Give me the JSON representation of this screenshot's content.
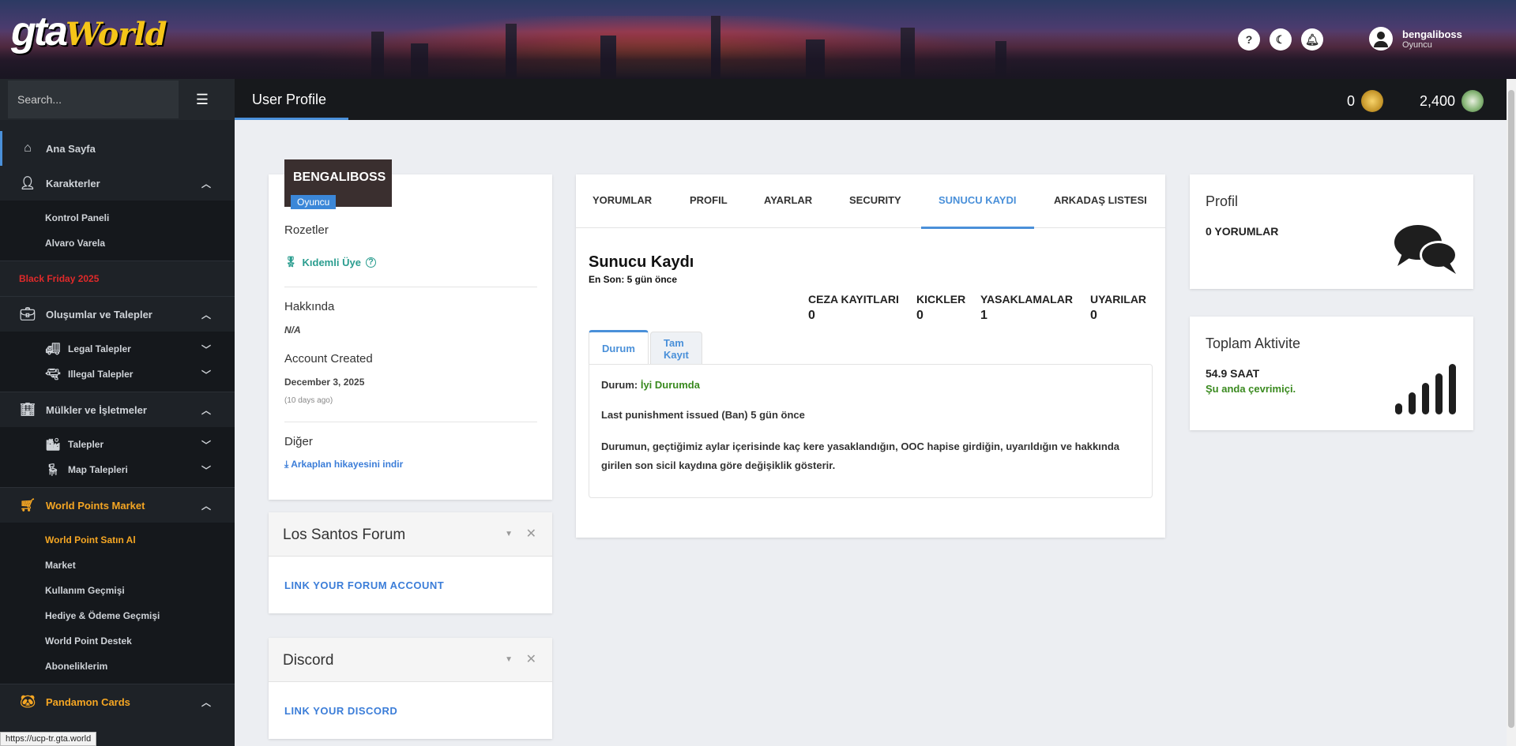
{
  "header": {
    "logo_main": "gta",
    "logo_sub": "World",
    "help_icon": "?",
    "user_name": "bengaliboss",
    "user_role": "Oyuncu"
  },
  "sidebar": {
    "search_placeholder": "Search...",
    "items": [
      {
        "label": "Ana Sayfa"
      },
      {
        "label": "Karakterler"
      },
      {
        "label": "Kontrol Paneli"
      },
      {
        "label": "Alvaro Varela"
      },
      {
        "label": "Black Friday 2025"
      },
      {
        "label": "Oluşumlar ve Talepler"
      },
      {
        "label": "Legal Talepler"
      },
      {
        "label": "Illegal Talepler"
      },
      {
        "label": "Mülkler ve İşletmeler"
      },
      {
        "label": "Talepler"
      },
      {
        "label": "Map Talepleri"
      },
      {
        "label": "World Points Market"
      },
      {
        "label": "World Point Satın Al"
      },
      {
        "label": "Market"
      },
      {
        "label": "Kullanım Geçmişi"
      },
      {
        "label": "Hediye & Ödeme Geçmişi"
      },
      {
        "label": "World Point Destek"
      },
      {
        "label": "Aboneliklerim"
      },
      {
        "label": "Pandamon Cards"
      }
    ],
    "status_url": "https://ucp-tr.gta.world"
  },
  "topbar": {
    "title": "User Profile",
    "points_gold": "0",
    "points_green": "2,400"
  },
  "profile": {
    "name": "BENGALIBOSS",
    "role": "Oyuncu",
    "badges_label": "Rozetler",
    "badge": "Kıdemli Üye",
    "about_label": "Hakkında",
    "about_value": "N/A",
    "created_label": "Account Created",
    "created_value": "December 3, 2025",
    "created_ago": "(10 days ago)",
    "other_label": "Diğer",
    "download_link": "Arkaplan hikayesini indir"
  },
  "forum": {
    "title": "Los Santos Forum",
    "link": "LINK YOUR FORUM ACCOUNT"
  },
  "discord": {
    "title": "Discord",
    "link": "LINK YOUR DISCORD"
  },
  "main": {
    "tabs": [
      {
        "label": "YORUMLAR"
      },
      {
        "label": "PROFIL"
      },
      {
        "label": "AYARLAR"
      },
      {
        "label": "SECURITY"
      },
      {
        "label": "SUNUCU KAYDI"
      },
      {
        "label": "ARKADAŞ LISTESI"
      }
    ],
    "title": "Sunucu Kaydı",
    "subtitle": "En Son: 5 gün önce",
    "stats": [
      {
        "label": "CEZA KAYITLARI",
        "value": "0"
      },
      {
        "label": "KICKLER",
        "value": "0"
      },
      {
        "label": "YASAKLAMALAR",
        "value": "1"
      },
      {
        "label": "UYARILAR",
        "value": "0"
      }
    ],
    "subtabs": [
      {
        "label": "Durum"
      },
      {
        "label": "Tam Kayıt"
      }
    ],
    "status_prefix": "Durum:",
    "status_value": "İyi Durumda",
    "last_punishment": "Last punishment issued (Ban) 5 gün önce",
    "description": "Durumun, geçtiğimiz aylar içerisinde kaç kere yasaklandığın, OOC hapise girdiğin, uyarıldığın ve hakkında girilen son sicil kaydına göre değişiklik gösterir."
  },
  "right": {
    "profile_title": "Profil",
    "comments": "0 YORUMLAR",
    "activity_title": "Toplam Aktivite",
    "hours": "54.9 SAAT",
    "online": "Şu anda çevrimiçi."
  }
}
